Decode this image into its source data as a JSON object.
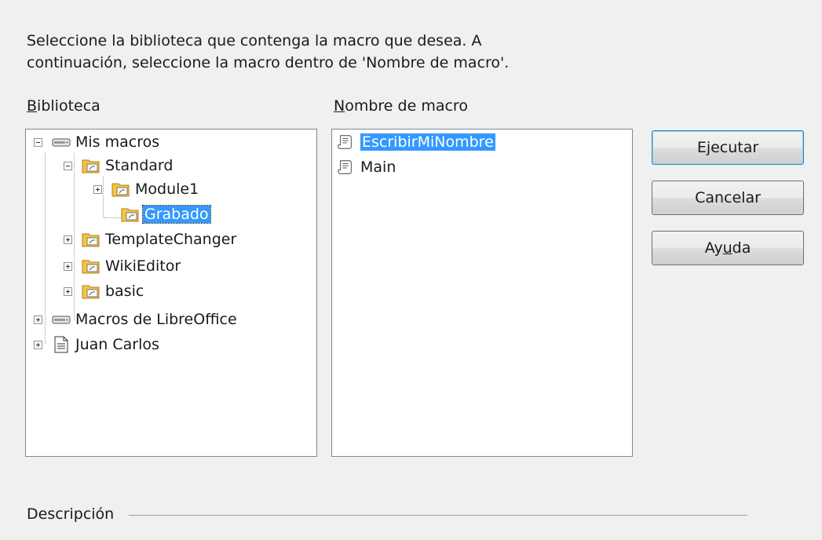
{
  "intro": {
    "line1": "Seleccione la biblioteca que contenga la macro que desea. A",
    "line2": "continuación, seleccione la macro dentro de 'Nombre de macro'."
  },
  "library": {
    "label_prefix": "B",
    "label_rest": "iblioteca",
    "tree": [
      {
        "label": "Mis macros",
        "icon": "drive-icon",
        "expander": "minus"
      },
      {
        "label": "Standard",
        "icon": "library-folder-icon",
        "expander": "minus"
      },
      {
        "label": "Module1",
        "icon": "library-folder-icon",
        "expander": "plus"
      },
      {
        "label": "Grabado",
        "icon": "library-folder-icon",
        "expander": "none",
        "selected": true
      },
      {
        "label": "TemplateChanger",
        "icon": "library-folder-icon",
        "expander": "plus"
      },
      {
        "label": "WikiEditor",
        "icon": "library-folder-icon",
        "expander": "plus"
      },
      {
        "label": "basic",
        "icon": "library-folder-icon",
        "expander": "plus"
      },
      {
        "label": "Macros de LibreOffice",
        "icon": "drive-icon",
        "expander": "plus"
      },
      {
        "label": "Juan Carlos",
        "icon": "document-icon",
        "expander": "plus"
      }
    ]
  },
  "macros": {
    "label_prefix": "N",
    "label_rest": "ombre de macro",
    "items": [
      {
        "label": "EscribirMiNombre",
        "icon": "macro-script-icon",
        "selected": true
      },
      {
        "label": "Main",
        "icon": "macro-script-icon"
      }
    ]
  },
  "buttons": {
    "run_label": "Ejecutar",
    "cancel_label": "Cancelar",
    "help_pre": "Ay",
    "help_u": "u",
    "help_post": "da"
  },
  "description": {
    "label": "Descripción"
  },
  "colors": {
    "selection": "#3399ff",
    "background": "#f0f0f0",
    "folder": "#f5c447"
  }
}
